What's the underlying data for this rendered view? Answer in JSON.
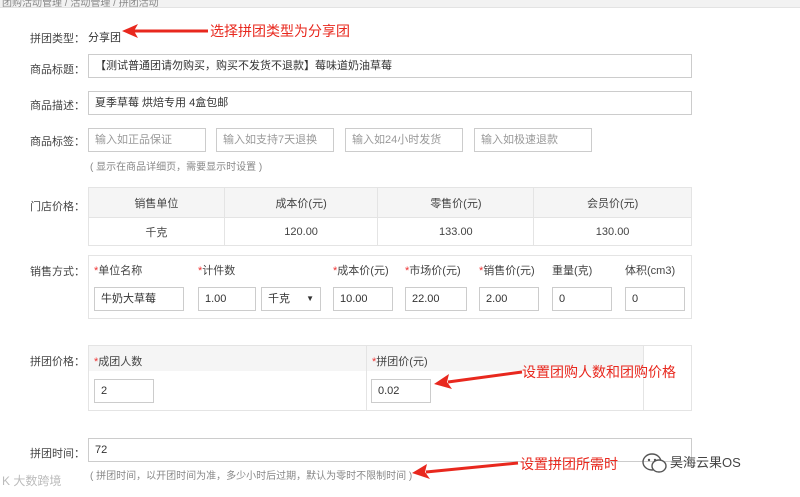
{
  "breadcrumb": "团购活动管理 / 活动管理 / 拼团活动",
  "group_type": {
    "label": "拼团类型：",
    "value": "分享团",
    "annotation": "选择拼团类型为分享团"
  },
  "title": {
    "label": "商品标题：",
    "value": "【测试普通团请勿购买，购买不发货不退款】莓味道奶油草莓"
  },
  "desc": {
    "label": "商品描述：",
    "value": "夏季草莓 烘焙专用 4盒包邮"
  },
  "tags": {
    "label": "商品标签：",
    "placeholders": [
      "输入如正品保证",
      "输入如支持7天退换",
      "输入如24小时发货",
      "输入如极速退款"
    ],
    "hint": "( 显示在商品详细页，需要显示时设置 )"
  },
  "store_price": {
    "label": "门店价格：",
    "headers": [
      "销售单位",
      "成本价(元)",
      "零售价(元)",
      "会员价(元)"
    ],
    "row": [
      "千克",
      "120.00",
      "133.00",
      "130.00"
    ]
  },
  "sale_mode": {
    "label": "销售方式：",
    "headers": {
      "unit_name": "单位名称",
      "count": "计件数",
      "cost": "成本价(元)",
      "market": "市场价(元)",
      "sale": "销售价(元)",
      "weight": "重量(克)",
      "volume": "体积(cm3)"
    },
    "values": {
      "unit_name": "牛奶大草莓",
      "count": "1.00",
      "unit": "千克",
      "cost": "10.00",
      "market": "22.00",
      "sale": "2.00",
      "weight": "0",
      "volume": "0"
    }
  },
  "group_price": {
    "label": "拼团价格：",
    "people_header": "成团人数",
    "price_header": "拼团价(元)",
    "people_value": "2",
    "price_value": "0.02",
    "annotation": "设置团购人数和团购价格"
  },
  "group_time": {
    "label": "拼团时间：",
    "value": "72",
    "hint": "( 拼团时间，以开团时间为准，多少小时后过期，默认为零时不限制时间 )",
    "annotation": "设置拼团所需时"
  },
  "watermark_right": "昊海云果OS",
  "watermark_left": "K 大数跨境",
  "colors": {
    "annotation": "#e8281e",
    "border": "#cccccc",
    "header_bg": "#f5f5f5"
  }
}
